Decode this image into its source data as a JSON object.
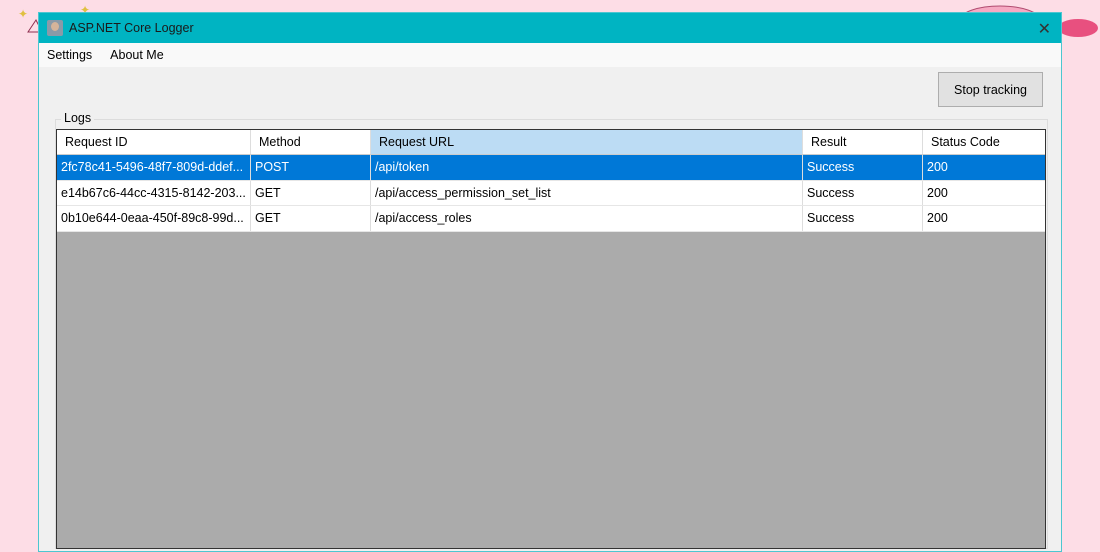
{
  "window": {
    "title": "ASP.NET Core Logger"
  },
  "menu": [
    "Settings",
    "About Me"
  ],
  "stop_button": "Stop tracking",
  "group_label": "Logs",
  "table": {
    "columns": [
      "Request ID",
      "Method",
      "Request URL",
      "Result",
      "Status Code"
    ],
    "rows": [
      [
        "2fc78c41-5496-48f7-809d-ddef...",
        "POST",
        "/api/token",
        "Success",
        "200"
      ],
      [
        "e14b67c6-44cc-4315-8142-203...",
        "GET",
        "/api/access_permission_set_list",
        "Success",
        "200"
      ],
      [
        "0b10e644-0eaa-450f-89c8-99d...",
        "GET",
        "/api/access_roles",
        "Success",
        "200"
      ]
    ]
  },
  "colors": {
    "titlebar": "#00b4c2",
    "selection": "#0078d7"
  }
}
